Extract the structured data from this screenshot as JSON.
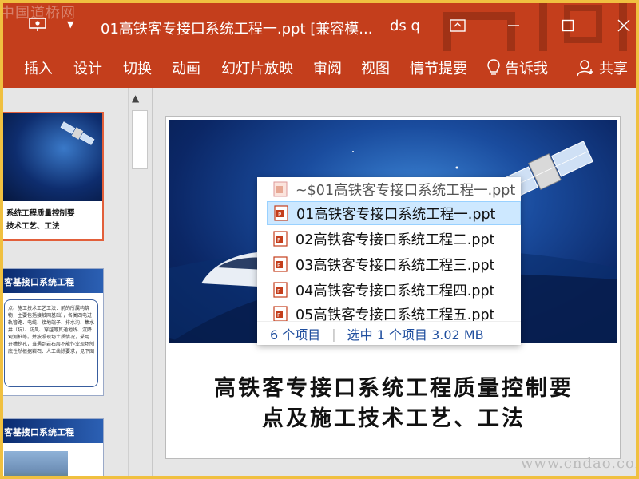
{
  "window": {
    "doc_title": "01高铁客专接口系统工程一.ppt [兼容模...",
    "user": "ds q",
    "watermark_tl": "中国道桥网"
  },
  "ribbon": {
    "tabs": [
      "插入",
      "设计",
      "切换",
      "动画",
      "幻灯片放映",
      "审阅",
      "视图",
      "情节提要"
    ],
    "tell_me": "告诉我",
    "share": "共享"
  },
  "thumbnails": {
    "slide1_title_line1": "系统工程质量控制要",
    "slide1_title_line2": "技术工艺、工法",
    "slide2_header": "客基接口系统工程",
    "slide2_body": "点、施工技术工艺工法：前的所属构筑物，主要包括接触网基础），各类四电过轨管路、电缆、接地端子、排水沟、集水井（坑）、防风、穿越等贯通地线、沉降观测桩等。并按照现场土质情况，采用二开槽挖孔，当遇到岩石层不能作业现场刨底性然根据岩石、人工凿除要求，见下图",
    "slide3_header": "客基接口系统工程"
  },
  "slide": {
    "title_line1": "高铁客专接口系统工程质量控制要",
    "title_line2": "点及施工技术工艺、工法"
  },
  "file_popup": {
    "files": [
      "~$01高铁客专接口系统工程一.ppt",
      "01高铁客专接口系统工程一.ppt",
      "02高铁客专接口系统工程二.ppt",
      "03高铁客专接口系统工程三.ppt",
      "04高铁客专接口系统工程四.ppt",
      "05高铁客专接口系统工程五.ppt"
    ],
    "selected_index": 1,
    "item_count": "6 个项目",
    "selection": "选中 1 个项目  3.02 MB"
  },
  "watermark_br": "www.cndao.com",
  "colors": {
    "accent": "#c43e1c",
    "selection": "#cde8ff",
    "status_text": "#1f4e9e"
  }
}
